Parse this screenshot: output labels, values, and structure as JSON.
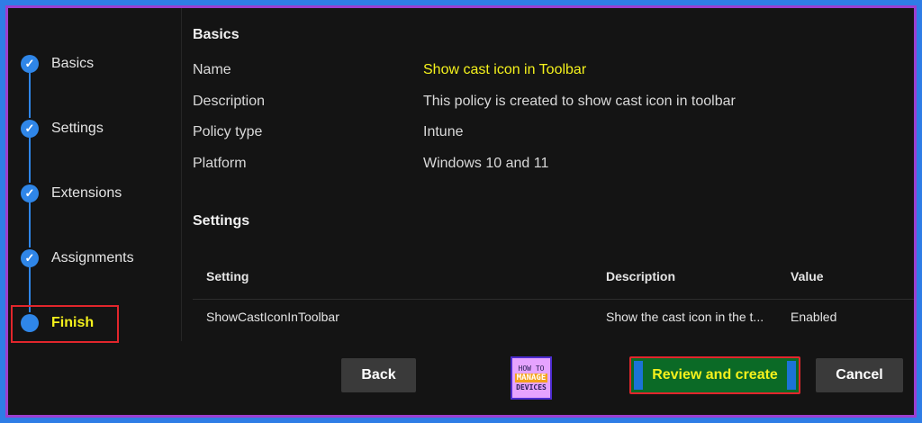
{
  "steps": [
    {
      "label": "Basics",
      "state": "completed"
    },
    {
      "label": "Settings",
      "state": "completed"
    },
    {
      "label": "Extensions",
      "state": "completed"
    },
    {
      "label": "Assignments",
      "state": "completed"
    },
    {
      "label": "Finish",
      "state": "current"
    }
  ],
  "basics": {
    "title": "Basics",
    "fields": [
      {
        "label": "Name",
        "value": "Show cast icon in Toolbar"
      },
      {
        "label": "Description",
        "value": "This policy is created to show cast icon in toolbar"
      },
      {
        "label": "Policy type",
        "value": "Intune"
      },
      {
        "label": "Platform",
        "value": "Windows 10 and 11"
      }
    ]
  },
  "settings": {
    "title": "Settings",
    "columns": [
      "Setting",
      "Description",
      "Value"
    ],
    "rows": [
      {
        "setting": "ShowCastIconInToolbar",
        "description": "Show the cast icon in the t...",
        "value": "Enabled"
      }
    ]
  },
  "footer": {
    "back_label": "Back",
    "review_label": "Review and create",
    "cancel_label": "Cancel"
  },
  "logo": {
    "line1": "HOW TO",
    "line2": "MANAGE",
    "line3": "DEVICES"
  },
  "colors": {
    "accent": "#2f86e8",
    "highlight": "#f4f11c",
    "primary_button": "#0b6a26",
    "annotation_red": "#e2262c",
    "outer_frame": "#2f7de6"
  }
}
